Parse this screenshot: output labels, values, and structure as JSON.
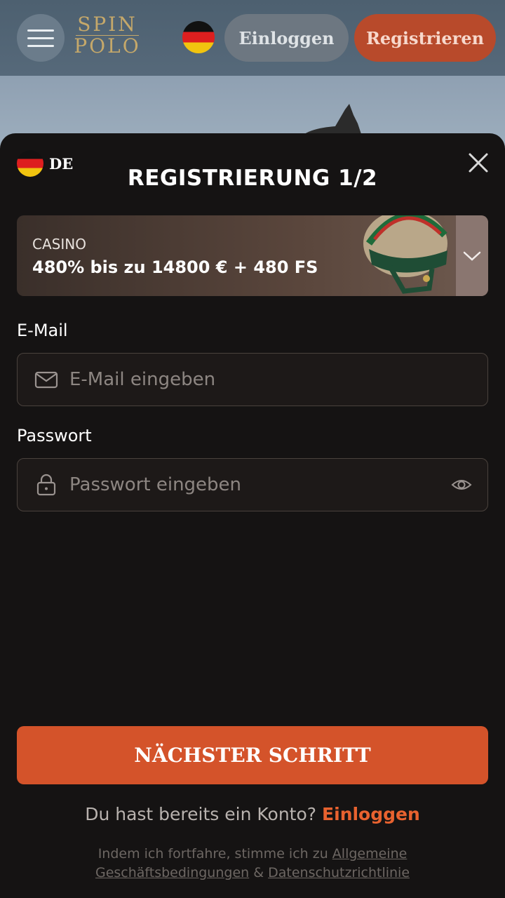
{
  "header": {
    "logo_line1": "SPIN",
    "logo_line2": "POLO",
    "login_label": "Einloggen",
    "register_label": "Registrieren"
  },
  "modal": {
    "lang_code": "DE",
    "title": "REGISTRIERUNG 1/2",
    "bonus": {
      "category": "CASINO",
      "offer": "480% bis zu 14800 € + 480 FS"
    },
    "email": {
      "label": "E-Mail",
      "placeholder": "E-Mail eingeben",
      "value": ""
    },
    "password": {
      "label": "Passwort",
      "placeholder": "Passwort eingeben",
      "value": ""
    },
    "next_label": "NÄCHSTER SCHRITT",
    "have_account_text": "Du hast bereits ein Konto?",
    "have_account_link": "Einloggen",
    "terms_prefix": "Indem ich fortfahre, stimme ich zu",
    "terms_link": "Allgemeine Geschäftsbedingungen",
    "terms_and": "&",
    "privacy_link": "Datenschutzrichtlinie"
  },
  "colors": {
    "accent": "#d4532a",
    "register_top": "#b84a2b",
    "modal_bg": "#151313",
    "link": "#e8622f"
  },
  "icons": {
    "menu": "hamburger-icon",
    "flag": "germany-flag-icon",
    "close": "close-icon",
    "chevron": "chevron-down-icon",
    "mail": "envelope-icon",
    "lock": "lock-icon",
    "eye": "eye-icon"
  }
}
